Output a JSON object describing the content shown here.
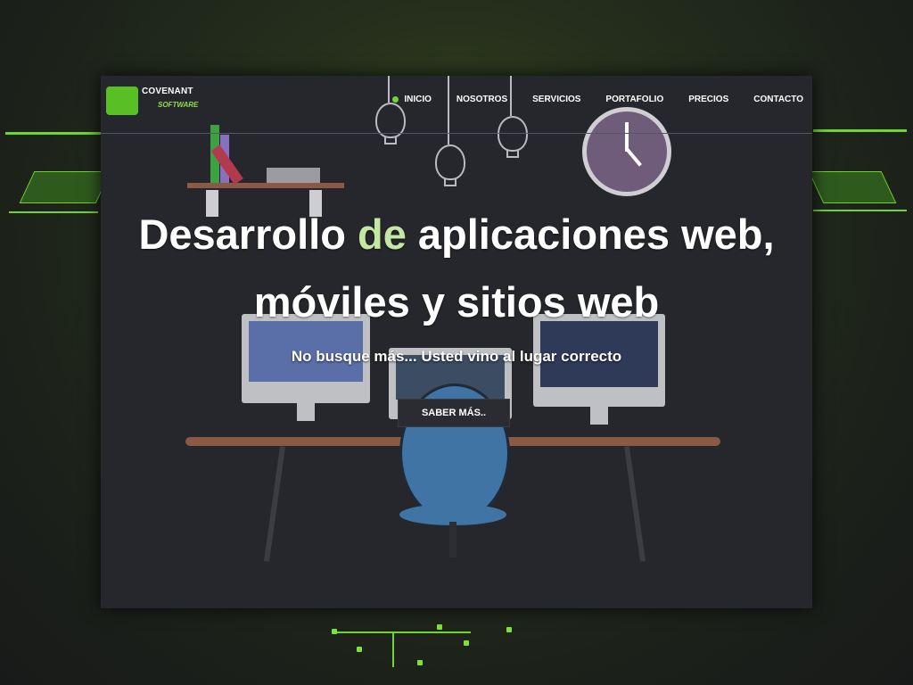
{
  "brand": {
    "name_line1": "COVENANT",
    "name_line2": "SOFTWARE"
  },
  "nav": {
    "items": [
      {
        "label": "INICIO",
        "active": true
      },
      {
        "label": "NOSOTROS",
        "active": false
      },
      {
        "label": "SERVICIOS",
        "active": false
      },
      {
        "label": "PORTAFOLIO",
        "active": false
      },
      {
        "label": "PRECIOS",
        "active": false
      },
      {
        "label": "CONTACTO",
        "active": false
      }
    ]
  },
  "hero": {
    "title_part1": "Desarrollo ",
    "title_accent": "de",
    "title_part2": " aplicaciones web,",
    "title_line2": "móviles y sitios web",
    "subtitle": "No busque más... Usted vino al lugar correcto",
    "cta_label": "SABER MÁS.."
  },
  "colors": {
    "accent": "#6fd62f",
    "window_bg": "#26272c",
    "chair": "#3f74a4"
  }
}
